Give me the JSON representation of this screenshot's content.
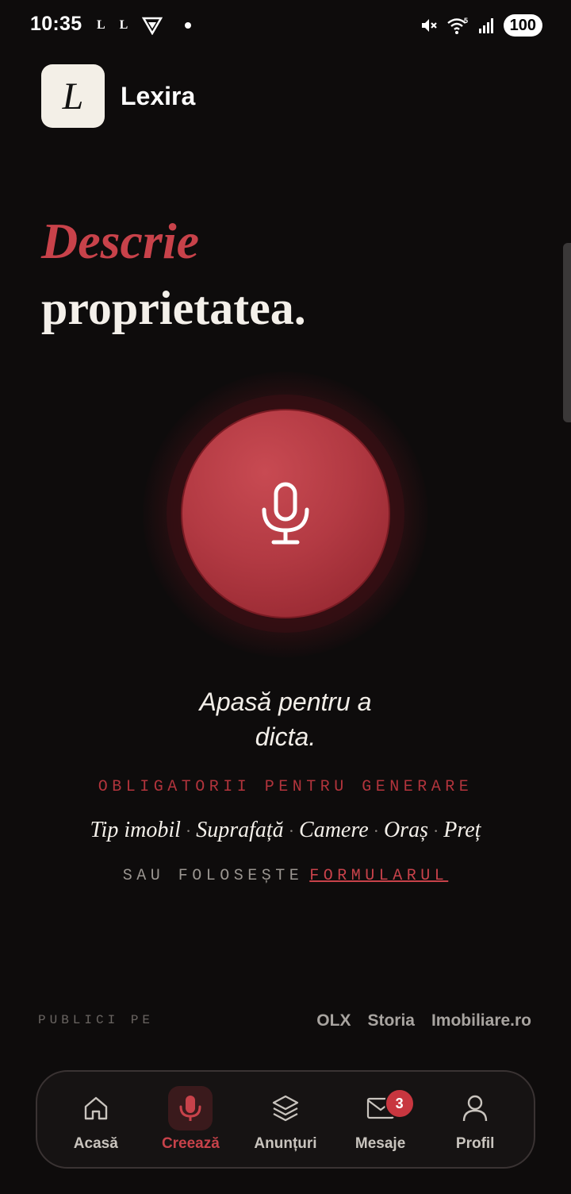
{
  "status_bar": {
    "time": "10:35",
    "left_icons": [
      "L",
      "L"
    ],
    "battery": "100",
    "network": "5"
  },
  "header": {
    "logo_letter": "L",
    "app_name": "Lexira"
  },
  "hero": {
    "title_accent": "Descrie",
    "title_main": "proprietatea."
  },
  "mic": {
    "icon": "microphone-icon",
    "hint": "Apasă pentru a dicta."
  },
  "requirements": {
    "label": "OBLIGATORII PENTRU GENERARE",
    "fields": [
      "Tip imobil",
      "Suprafață",
      "Camere",
      "Oraș",
      "Preț"
    ]
  },
  "alternative": {
    "prefix": "SAU FOLOSEȘTE",
    "link": "FORMULARUL"
  },
  "publish": {
    "label": "PUBLICI PE",
    "platforms": [
      "OLX",
      "Storia",
      "Imobiliare.ro"
    ]
  },
  "nav": {
    "items": [
      {
        "label": "Acasă",
        "icon": "home-icon"
      },
      {
        "label": "Creează",
        "icon": "microphone-icon"
      },
      {
        "label": "Anunțuri",
        "icon": "layers-icon"
      },
      {
        "label": "Mesaje",
        "icon": "mail-icon",
        "badge": "3"
      },
      {
        "label": "Profil",
        "icon": "user-icon"
      }
    ],
    "active_index": 1
  },
  "colors": {
    "accent": "#c8424a",
    "background": "#0e0c0c",
    "text": "#f4f0ea"
  }
}
